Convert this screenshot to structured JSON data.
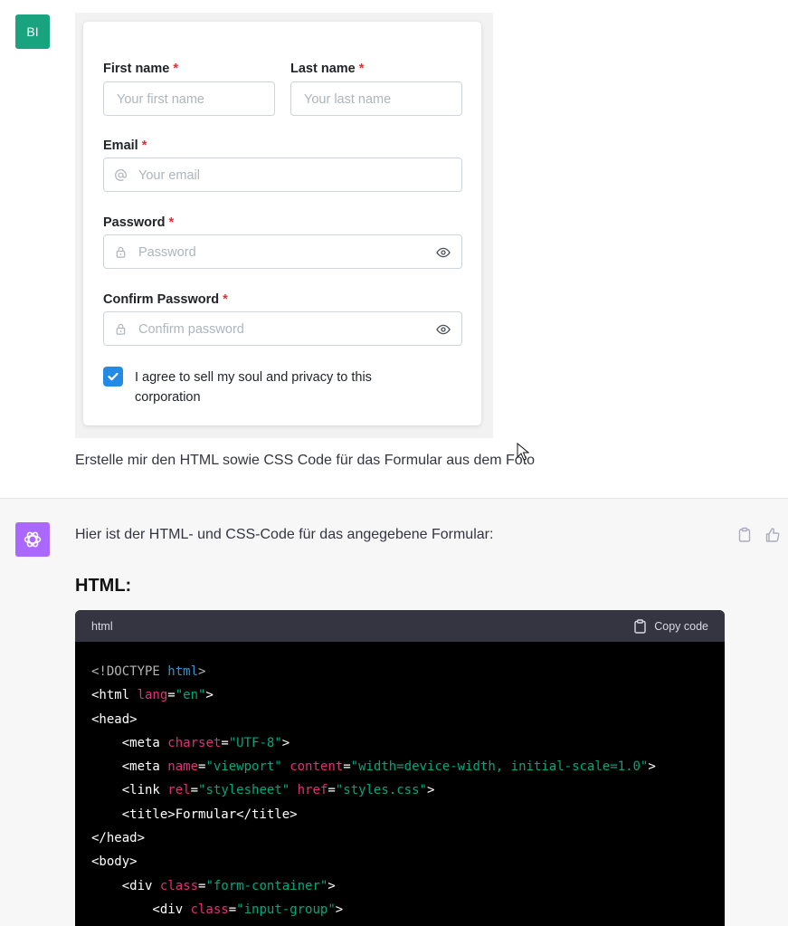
{
  "user": {
    "avatar_initials": "BI"
  },
  "form": {
    "first_name_label": "First name",
    "first_name_placeholder": "Your first name",
    "last_name_label": "Last name",
    "last_name_placeholder": "Your last name",
    "email_label": "Email",
    "email_placeholder": "Your email",
    "password_label": "Password",
    "password_placeholder": "Password",
    "confirm_label": "Confirm Password",
    "confirm_placeholder": "Confirm password",
    "required_mark": "*",
    "agree_text": "I agree to sell my soul and privacy to this corporation",
    "agree_checked": true
  },
  "prompt_text": "Erstelle mir den HTML sowie CSS Code für das Formular aus dem Foto",
  "assistant": {
    "reply_text": "Hier ist der HTML- und CSS-Code für das angegebene Formular:",
    "heading": "HTML:",
    "code_lang": "html",
    "copy_label": "Copy code"
  },
  "colors": {
    "user_avatar": "#19a37f",
    "bot_avatar": "#ab68ff",
    "checkbox": "#228be6",
    "required": "#e03131"
  }
}
